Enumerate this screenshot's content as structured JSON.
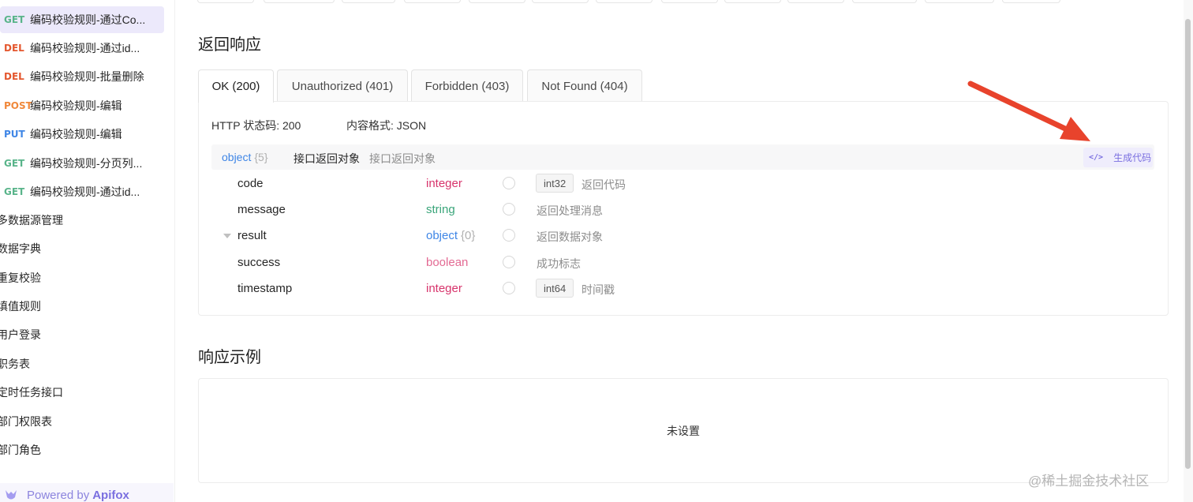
{
  "sidebar": {
    "api_items": [
      {
        "method": "GET",
        "name": "编码校验规则-通过Co..."
      },
      {
        "method": "DEL",
        "name": "编码校验规则-通过id..."
      },
      {
        "method": "DEL",
        "name": "编码校验规则-批量删除"
      },
      {
        "method": "POST",
        "name": "编码校验规则-编辑"
      },
      {
        "method": "PUT",
        "name": "编码校验规则-编辑"
      },
      {
        "method": "GET",
        "name": "编码校验规则-分页列..."
      },
      {
        "method": "GET",
        "name": "编码校验规则-通过id..."
      }
    ],
    "folders": [
      "多数据源管理",
      "数据字典",
      "重复校验",
      "填值规则",
      "用户登录",
      "职务表",
      "定时任务接口",
      "部门权限表",
      "部门角色"
    ],
    "powered_prefix": "Powered by",
    "powered_brand": "Apifox"
  },
  "response": {
    "section_title": "返回响应",
    "tabs": [
      "OK (200)",
      "Unauthorized (401)",
      "Forbidden (403)",
      "Not Found (404)"
    ],
    "status_code_label": "HTTP 状态码: 200",
    "content_type_label": "内容格式: JSON",
    "root": {
      "type": "object",
      "count": "{5}",
      "title": "接口返回对象",
      "description": "接口返回对象",
      "generate_code_label": "生成代码"
    },
    "fields": [
      {
        "name": "code",
        "type": "integer",
        "format": "int32",
        "description": "返回代码"
      },
      {
        "name": "message",
        "type": "string",
        "format": "",
        "description": "返回处理消息"
      },
      {
        "name": "result",
        "type": "object",
        "count": "{0}",
        "format": "",
        "description": "返回数据对象"
      },
      {
        "name": "success",
        "type": "boolean",
        "format": "",
        "description": "成功标志"
      },
      {
        "name": "timestamp",
        "type": "integer",
        "format": "int64",
        "description": "时间戳"
      }
    ]
  },
  "example": {
    "section_title": "响应示例",
    "empty_text": "未设置"
  },
  "watermark": "@稀土掘金技术社区",
  "colors": {
    "accent": "#7a6fe0",
    "get": "#59b48a",
    "del": "#e4572e",
    "post": "#f0883a",
    "put": "#3f86e6",
    "annotation_arrow": "#e8432c"
  }
}
